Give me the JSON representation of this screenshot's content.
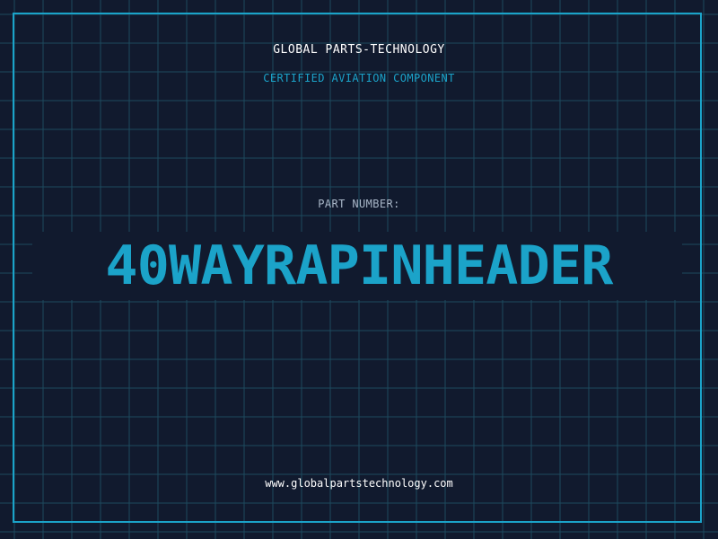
{
  "header": {
    "company": "GLOBAL PARTS-TECHNOLOGY",
    "subtitle": "CERTIFIED AVIATION COMPONENT"
  },
  "part": {
    "label": "PART NUMBER:",
    "number": "40WAYRAPINHEADER"
  },
  "footer": {
    "url": "www.globalpartstechnology.com"
  },
  "colors": {
    "background": "#111a2e",
    "accent": "#1ba3c9",
    "grid": "#1d4a5e"
  }
}
